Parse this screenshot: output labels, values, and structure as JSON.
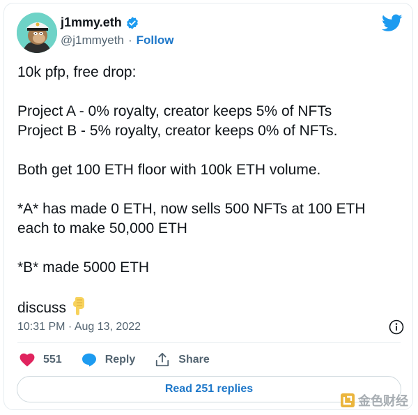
{
  "author": {
    "display_name": "j1mmy.eth",
    "handle": "@j1mmyeth",
    "separator": "·",
    "follow_label": "Follow",
    "verified": true
  },
  "tweet": {
    "text": "10k pfp, free drop:\n\nProject A - 0% royalty, creator keeps 5% of NFTs\nProject B - 5% royalty, creator keeps 0% of NFTs.\n\nBoth get 100 ETH floor with 100k ETH volume.\n\n*A* has made 0 ETH, now sells 500 NFTs at 100 ETH each to make 50,000 ETH\n\n*B* made 5000 ETH\n\ndiscuss",
    "emoji": "👇",
    "timestamp": "10:31 PM · Aug 13, 2022"
  },
  "actions": {
    "like_count": "551",
    "reply_label": "Reply",
    "share_label": "Share"
  },
  "read_replies_label": "Read 251 replies",
  "watermark_text": "金色财经",
  "colors": {
    "accent": "#1d9bf0",
    "link": "#1d77c9",
    "like": "#e0245e",
    "secondary_text": "#536471"
  },
  "icons": [
    "avatar-ape",
    "verified-badge-icon",
    "twitter-bird-icon",
    "info-icon",
    "heart-icon",
    "reply-bubble-icon",
    "share-icon",
    "pointing-down-emoji"
  ]
}
